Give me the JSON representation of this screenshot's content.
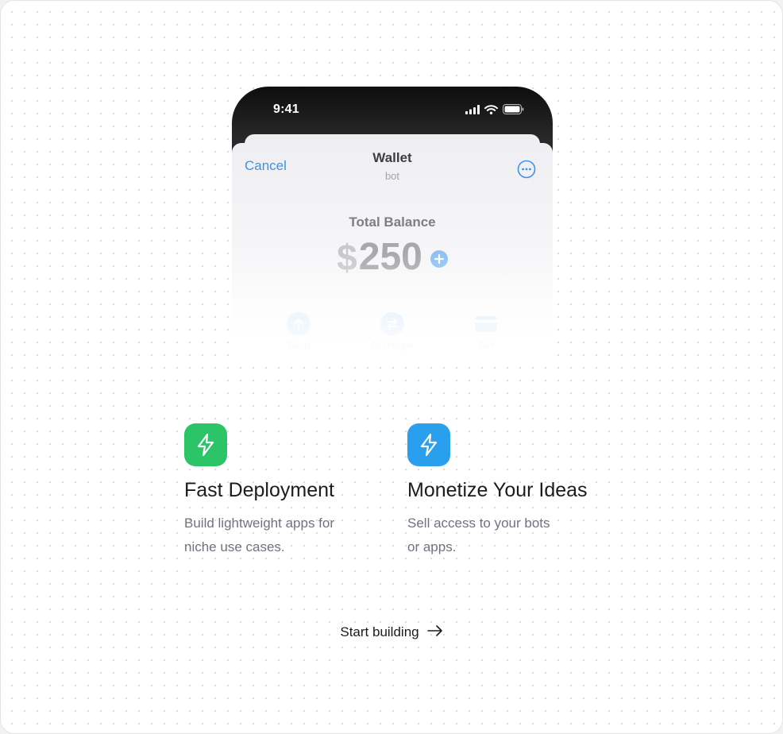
{
  "status_bar": {
    "time": "9:41",
    "icons": [
      "signal-icon",
      "wifi-icon",
      "battery-icon"
    ]
  },
  "wallet": {
    "nav": {
      "cancel_label": "Cancel",
      "title": "Wallet",
      "subtitle": "bot",
      "more_icon": "more-icon"
    },
    "balance_label": "Total Balance",
    "currency": "$",
    "amount": "250",
    "add_icon": "plus-icon",
    "actions": [
      {
        "label": "Send",
        "icon": "arrow-up-icon"
      },
      {
        "label": "Exchange",
        "icon": "exchange-icon"
      },
      {
        "label": "Sell",
        "icon": "card-icon"
      }
    ]
  },
  "features": [
    {
      "title": "Fast Deployment",
      "description_lines": [
        "Build lightweight apps for",
        "niche use cases."
      ],
      "icon": "lightning-icon",
      "icon_color": "#2bc466"
    },
    {
      "title": "Monetize Your Ideas",
      "description_lines": [
        "Sell access to your bots",
        "or apps."
      ],
      "icon": "lightning-icon",
      "icon_color": "#2a9fee"
    }
  ],
  "cta": {
    "label": "Start building",
    "icon": "arrow-right-icon"
  },
  "colors": {
    "accent_blue": "#3a93e8",
    "green": "#2bc466",
    "blue": "#2a9fee"
  }
}
